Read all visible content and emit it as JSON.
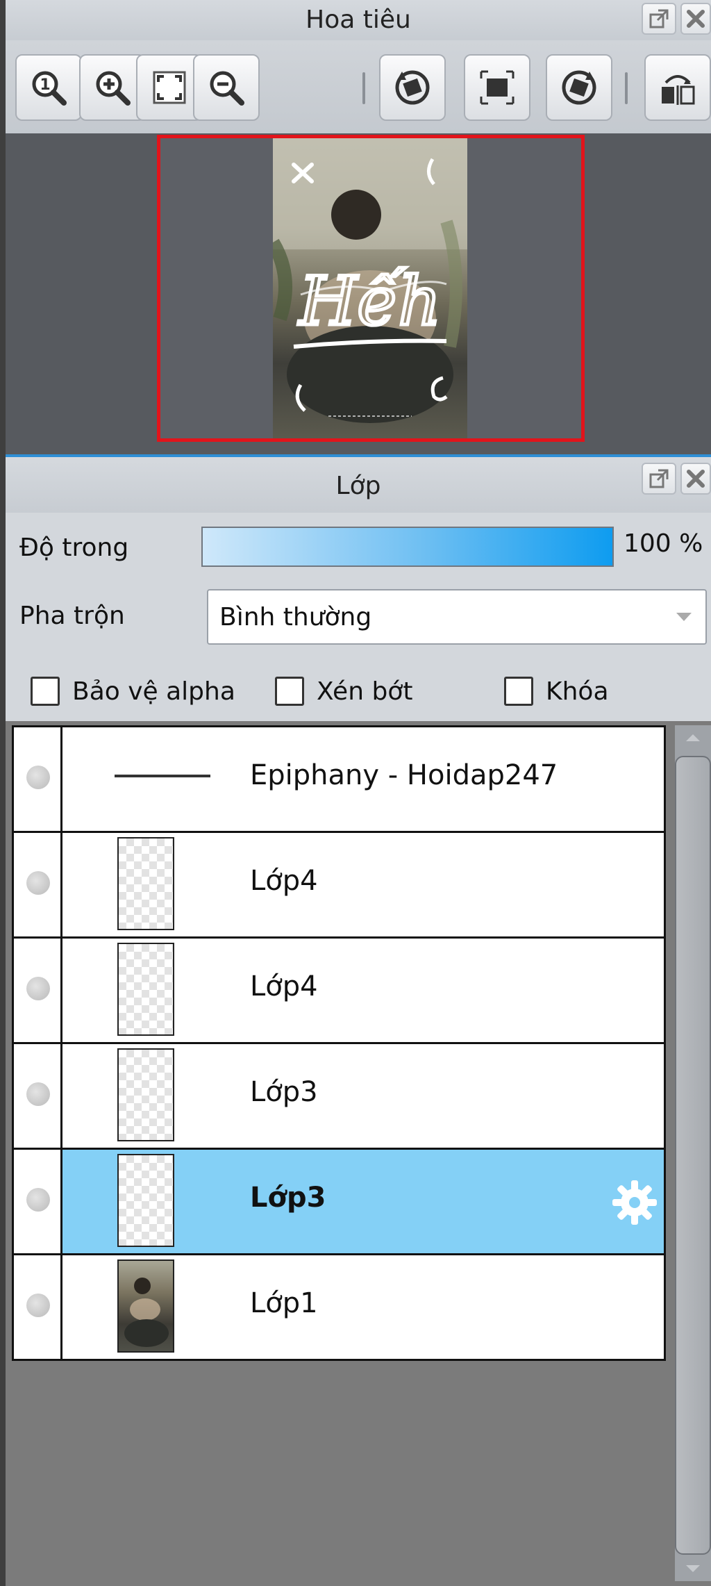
{
  "navigator": {
    "title": "Hoa tiêu",
    "toolbar": [
      {
        "icon": "zoom-actual-size-icon"
      },
      {
        "icon": "zoom-in-icon"
      },
      {
        "icon": "fit-to-window-icon"
      },
      {
        "icon": "zoom-out-icon"
      },
      {
        "icon": "rotate-left-icon"
      },
      {
        "icon": "reset-rotation-icon"
      },
      {
        "icon": "rotate-right-icon"
      },
      {
        "icon": "flip-horizontal-icon"
      }
    ],
    "preview_text": "Hếh"
  },
  "layers": {
    "title": "Lớp",
    "opacity_label": "Độ trong",
    "opacity_value": "100 %",
    "opacity_percent": 100,
    "blend_label": "Pha trộn",
    "blend_value": "Bình thường",
    "checkboxes": [
      {
        "label": "Bảo vệ alpha",
        "checked": false
      },
      {
        "label": "Xén bớt",
        "checked": false
      },
      {
        "label": "Khóa",
        "checked": false
      }
    ],
    "items": [
      {
        "name": "Epiphany - Hoidap247",
        "type": "folder",
        "selected": false
      },
      {
        "name": "Lớp4",
        "type": "layer",
        "selected": false
      },
      {
        "name": "Lớp4",
        "type": "layer",
        "selected": false
      },
      {
        "name": "Lớp3",
        "type": "layer",
        "selected": false
      },
      {
        "name": "Lớp3",
        "type": "layer",
        "selected": true
      },
      {
        "name": "Lớp1",
        "type": "photo",
        "selected": false
      }
    ]
  },
  "colors": {
    "selected_row": "#84d0f6",
    "navigator_frame": "#e2141b",
    "accent": "#2e8fd6"
  }
}
